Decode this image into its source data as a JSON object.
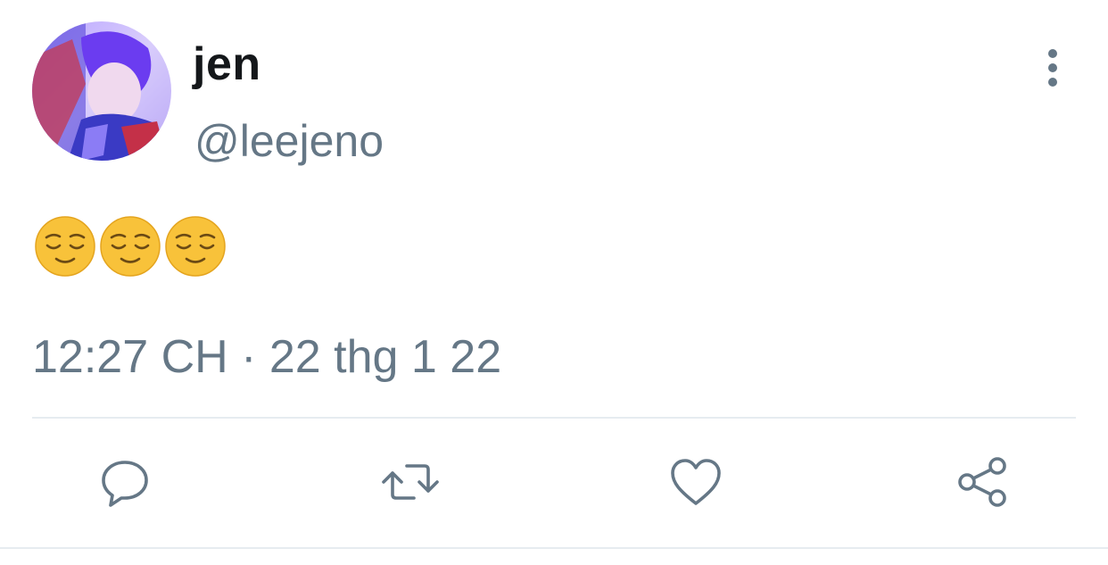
{
  "tweet": {
    "author": {
      "display_name": "jen",
      "handle": "@leejeno",
      "avatar": "avatar-photo"
    },
    "text": "😌😌😌",
    "timestamp": "12:27 CH · 22 thg 1 22",
    "actions": [
      {
        "name": "reply",
        "icon": "reply-icon"
      },
      {
        "name": "retweet",
        "icon": "retweet-icon"
      },
      {
        "name": "like",
        "icon": "heart-icon"
      },
      {
        "name": "share",
        "icon": "share-icon"
      }
    ],
    "menu_icon": "more-vertical-icon"
  },
  "colors": {
    "text_primary": "#14171a",
    "text_secondary": "#657786",
    "divider": "#e6ecf0",
    "icon": "#657786",
    "emoji_face": "#f8c23a"
  }
}
